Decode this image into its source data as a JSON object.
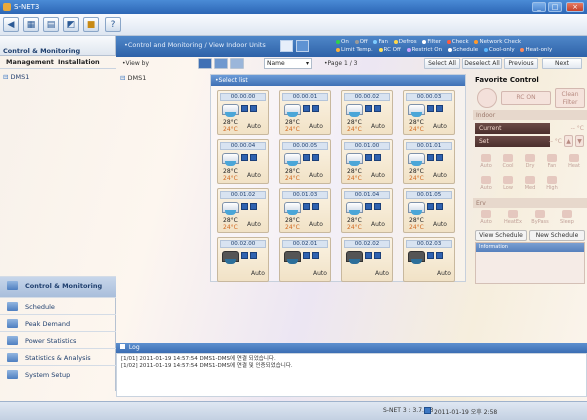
{
  "window": {
    "title": "S-NET3"
  },
  "left": {
    "header": "Control & Monitoring",
    "tabs": [
      "Management",
      "Installation"
    ],
    "tree_root": "DMS1"
  },
  "nav": {
    "items": [
      "Control & Monitoring",
      "Schedule",
      "Peak Demand",
      "Power Statistics",
      "Statistics & Analysis",
      "System Setup"
    ]
  },
  "main": {
    "breadcrumb": "•Control and Monitoring / View Indoor Units",
    "legend_row1": [
      "On",
      "Off",
      "Fan",
      "Defros",
      "Filter",
      "Check",
      "Network Check"
    ],
    "legend_row2": [
      "Limit Temp.",
      "RC Off",
      "Restrict On",
      "Schedule",
      "Cool-only",
      "Heat-only"
    ],
    "view_by_label": "•View by",
    "name_select": "Name",
    "page_label": "•Page 1 / 3",
    "buttons": [
      "Select All",
      "Deselect All",
      "Previous",
      "Next"
    ],
    "device_tree_root": "DMS1",
    "grid_header": "•Select list"
  },
  "colors": {
    "legend_on": "#2fd34a",
    "legend_off": "#9a9a9a",
    "legend_fan": "#7ecbff",
    "legend_defros": "#ffd84a",
    "legend_filter": "#ffffff",
    "legend_check": "#ff5a3c",
    "legend_network": "#ff9a2a",
    "legend_limit": "#ffb13a",
    "legend_rcoff": "#ffe25a",
    "legend_restrict": "#c8a0ff",
    "legend_schedule": "#ffffff",
    "legend_cool": "#5ab8ff",
    "legend_heat": "#ff8a5a"
  },
  "units": [
    {
      "id": "00.00.00",
      "set": "28°C",
      "cur": "24°C",
      "mode": "Auto",
      "status": "on"
    },
    {
      "id": "00.00.01",
      "set": "28°C",
      "cur": "24°C",
      "mode": "Auto",
      "status": "on"
    },
    {
      "id": "00.00.02",
      "set": "28°C",
      "cur": "24°C",
      "mode": "Auto",
      "status": "on"
    },
    {
      "id": "00.00.03",
      "set": "28°C",
      "cur": "24°C",
      "mode": "Auto",
      "status": "on"
    },
    {
      "id": "00.00.04",
      "set": "28°C",
      "cur": "24°C",
      "mode": "Auto",
      "status": "on"
    },
    {
      "id": "00.00.05",
      "set": "28°C",
      "cur": "24°C",
      "mode": "Auto",
      "status": "on"
    },
    {
      "id": "00.01.00",
      "set": "28°C",
      "cur": "24°C",
      "mode": "Auto",
      "status": "on"
    },
    {
      "id": "00.01.01",
      "set": "28°C",
      "cur": "24°C",
      "mode": "Auto",
      "status": "on"
    },
    {
      "id": "00.01.02",
      "set": "28°C",
      "cur": "24°C",
      "mode": "Auto",
      "status": "on"
    },
    {
      "id": "00.01.03",
      "set": "28°C",
      "cur": "24°C",
      "mode": "Auto",
      "status": "on"
    },
    {
      "id": "00.01.04",
      "set": "28°C",
      "cur": "24°C",
      "mode": "Auto",
      "status": "on"
    },
    {
      "id": "00.01.05",
      "set": "28°C",
      "cur": "24°C",
      "mode": "Auto",
      "status": "on"
    },
    {
      "id": "00.02.00",
      "set": "",
      "cur": "",
      "mode": "Auto",
      "status": "off"
    },
    {
      "id": "00.02.01",
      "set": "",
      "cur": "",
      "mode": "Auto",
      "status": "off"
    },
    {
      "id": "00.02.02",
      "set": "",
      "cur": "",
      "mode": "Auto",
      "status": "off"
    },
    {
      "id": "00.02.03",
      "set": "",
      "cur": "",
      "mode": "Auto",
      "status": "off"
    }
  ],
  "favorite": {
    "title": "Favorite Control",
    "rc_on": "RC ON",
    "clean_filter": "Clean Filter",
    "indoor_label": "Indoor",
    "current_label": "Current",
    "current_value": "-- °C",
    "set_label": "Set",
    "set_value": "-- °C",
    "modes": [
      "Auto",
      "Cool",
      "Dry",
      "Fan",
      "Heat"
    ],
    "fan_speeds": [
      "Auto",
      "Low",
      "Med",
      "High"
    ],
    "erv_label": "Erv",
    "erv_modes": [
      "Auto",
      "HeatEx",
      "ByPass",
      "Sleep"
    ],
    "erv_speeds": [
      "Low",
      "High",
      "Turbo"
    ],
    "view_schedule": "View Schedule",
    "new_schedule": "New Schedule",
    "schedule_header": "Information"
  },
  "log": {
    "title": "Log",
    "lines": [
      "[1/01] 2011-01-19 14:57:54 DMS1-DMS에 연결 되었습니다.",
      "[1/02] 2011-01-19 14:57:54 DMS1-DMS에 연결 및 인증되었습니다."
    ]
  },
  "status": {
    "text": "S-NET 3 : 3.7.1.3",
    "datetime": "2011-01-19  오후 2:58"
  }
}
